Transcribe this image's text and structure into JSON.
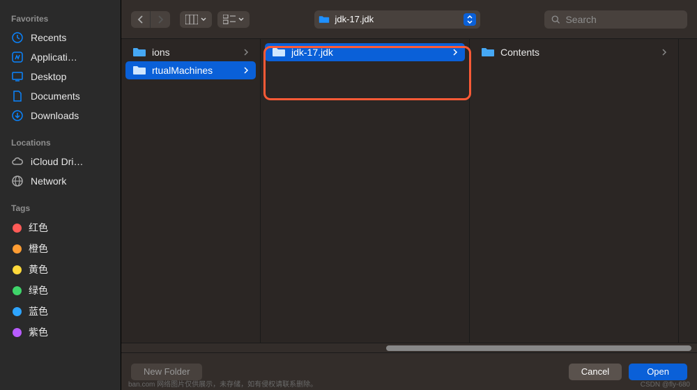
{
  "sidebar": {
    "favorites_title": "Favorites",
    "favorites": [
      {
        "icon": "clock",
        "label": "Recents"
      },
      {
        "icon": "app",
        "label": "Applicati…"
      },
      {
        "icon": "desktop",
        "label": "Desktop"
      },
      {
        "icon": "doc",
        "label": "Documents"
      },
      {
        "icon": "download",
        "label": "Downloads"
      }
    ],
    "locations_title": "Locations",
    "locations": [
      {
        "icon": "cloud",
        "label": "iCloud Dri…"
      },
      {
        "icon": "globe",
        "label": "Network"
      }
    ],
    "tags_title": "Tags",
    "tags": [
      {
        "color": "#ff5b57",
        "label": "红色"
      },
      {
        "color": "#ff9d33",
        "label": "橙色"
      },
      {
        "color": "#ffd93b",
        "label": "黄色"
      },
      {
        "color": "#3fd46a",
        "label": "绿色"
      },
      {
        "color": "#2ea4ff",
        "label": "蓝色"
      },
      {
        "color": "#b85cff",
        "label": "紫色"
      }
    ]
  },
  "toolbar": {
    "path_label": "jdk-17.jdk",
    "search_placeholder": "Search"
  },
  "columns": [
    {
      "items": [
        {
          "label": "ions",
          "selected": false
        },
        {
          "label": "rtualMachines",
          "selected": true
        }
      ]
    },
    {
      "items": [
        {
          "label": "jdk-17.jdk",
          "selected": true
        }
      ]
    },
    {
      "items": [
        {
          "label": "Contents",
          "selected": false
        }
      ]
    }
  ],
  "footer": {
    "new_folder": "New Folder",
    "cancel": "Cancel",
    "open": "Open"
  },
  "watermark_left": "ban.com 网络图片仅供展示，未存储，如有侵权请联系删除。",
  "watermark_right": "CSDN @fly-680"
}
